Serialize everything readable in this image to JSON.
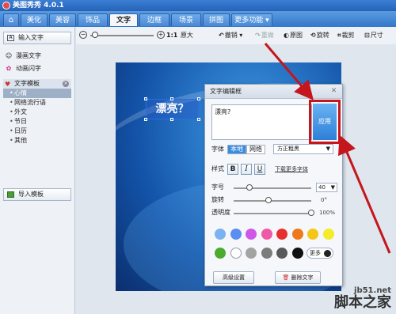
{
  "app": {
    "title": "美图秀秀 4.0.1"
  },
  "tabs": [
    {
      "label": "⌂"
    },
    {
      "label": "美化"
    },
    {
      "label": "美容"
    },
    {
      "label": "饰品"
    },
    {
      "label": "文字"
    },
    {
      "label": "边框"
    },
    {
      "label": "场景"
    },
    {
      "label": "拼图"
    },
    {
      "label": "更多功能 ▾"
    }
  ],
  "sidebar": {
    "input_text_button": "输入文字",
    "comic_text": "漫画文字",
    "animated_text": "动画闪字",
    "template_header": "文字模板",
    "template_items": [
      "心情",
      "网络流行语",
      "外文",
      "节日",
      "日历",
      "其他"
    ],
    "import_button": "导入模板"
  },
  "toolbar": {
    "zoom_minus": "−",
    "zoom_plus": "+",
    "ratio_label": "1:1",
    "original_size": "原大",
    "undo": "撤销",
    "redo": "重做",
    "original": "原图",
    "rotate": "旋转",
    "crop": "裁剪",
    "size": "尺寸"
  },
  "canvas": {
    "text_content": "漂亮？"
  },
  "dialog": {
    "title": "文字编辑框",
    "text_value": "漂亮?",
    "apply_button": "应用",
    "font_label": "字体",
    "font_local": "本地",
    "font_network": "网络",
    "font_selected": "方正粗黑",
    "style_label": "样式",
    "bold": "B",
    "italic": "I",
    "underline": "U",
    "download_fonts_link": "下载更多字体",
    "size_label": "字号",
    "size_value": "40",
    "size_fraction": 0.2,
    "rotate_label": "旋转",
    "rotate_value": "0°",
    "rotate_fraction": 0.45,
    "opacity_label": "透明度",
    "opacity_value": "100%",
    "opacity_fraction": 1.0,
    "colors_row1": [
      "#7ab3ee",
      "#5b8ef0",
      "#cf58e8",
      "#ee5aa8",
      "#e82f2f",
      "#f07818",
      "#f5c518",
      "#f2ec2a"
    ],
    "colors_row2": [
      "#4caa2e",
      "#ffffff",
      "#a3a3a3",
      "#7c7c7c",
      "#595959",
      "#111111"
    ],
    "more_colors": "更多",
    "advanced_button": "高级设置",
    "delete_button": "删除文字"
  },
  "watermark": {
    "site": "jb51.net",
    "name": "脚本之家"
  },
  "colors": {
    "highlight": "#c4161c",
    "accent": "#3b8ae0"
  }
}
